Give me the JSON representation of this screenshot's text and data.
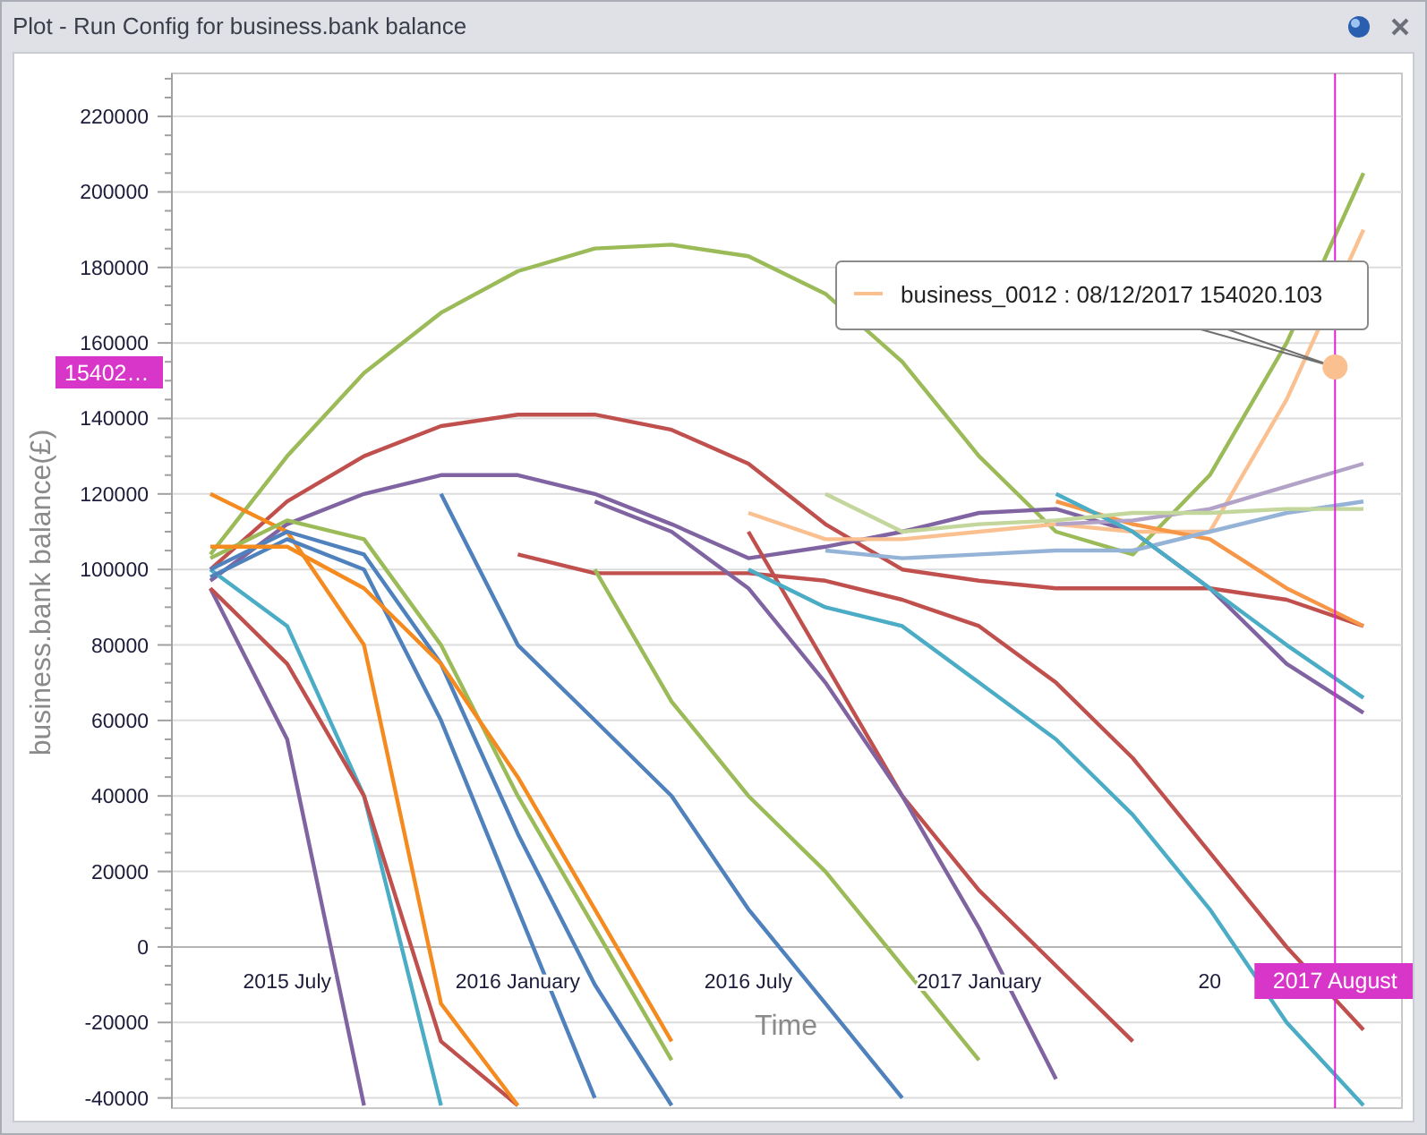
{
  "window": {
    "title": "Plot - Run Config for business.bank balance"
  },
  "chart_data": {
    "type": "line",
    "xlabel": "Time",
    "ylabel": "business.bank balance(£)",
    "categories": [
      null,
      "2015 July",
      null,
      null,
      "2016 January",
      null,
      null,
      "2016 July",
      null,
      null,
      "2017 January",
      null,
      null,
      "20",
      null,
      null
    ],
    "grid": true,
    "ylim": [
      -42700,
      231400
    ],
    "yticks": [
      -40000,
      -20000,
      0,
      20000,
      40000,
      60000,
      80000,
      100000,
      120000,
      140000,
      160000,
      180000,
      200000,
      220000
    ],
    "series": [
      {
        "color": "#9bbb59",
        "values": [
          104000,
          130000,
          152000,
          168000,
          179000,
          185000,
          186000,
          183000,
          173000,
          155000,
          130000,
          110000,
          104000,
          125000,
          160000,
          205000
        ]
      },
      {
        "color": "#c0504d",
        "values": [
          100000,
          118000,
          130000,
          138000,
          141000,
          141000,
          137000,
          128000,
          112000,
          100000,
          97000,
          95000,
          95000,
          95000,
          92000,
          85000
        ]
      },
      {
        "color": "#8064a2",
        "values": [
          97000,
          112000,
          120000,
          125000,
          125000,
          120000,
          112000,
          103000,
          106000,
          110000,
          115000,
          116000,
          110000,
          95000,
          75000,
          62000
        ]
      },
      {
        "color": "#8064a2",
        "values": [
          95000,
          55000,
          -42000,
          null,
          null,
          null,
          null,
          null,
          null,
          null,
          null,
          null,
          null,
          null,
          null,
          null
        ]
      },
      {
        "color": "#4bacc6",
        "values": [
          100000,
          85000,
          40000,
          -42000,
          null,
          null,
          null,
          null,
          null,
          null,
          null,
          null,
          null,
          null,
          null,
          null
        ]
      },
      {
        "color": "#c0504d",
        "values": [
          95000,
          75000,
          40000,
          -25000,
          -42000,
          null,
          null,
          null,
          null,
          null,
          null,
          null,
          null,
          null,
          null,
          null
        ]
      },
      {
        "color": "#f58a1f",
        "values": [
          120000,
          110000,
          80000,
          -15000,
          -42000,
          null,
          null,
          null,
          null,
          null,
          null,
          null,
          null,
          null,
          null,
          null
        ]
      },
      {
        "color": "#4f81bd",
        "values": [
          98000,
          108000,
          100000,
          60000,
          10000,
          -40000,
          null,
          null,
          null,
          null,
          null,
          null,
          null,
          null,
          null,
          null
        ]
      },
      {
        "color": "#4f81bd",
        "values": [
          100000,
          110000,
          104000,
          75000,
          30000,
          -10000,
          -42000,
          null,
          null,
          null,
          null,
          null,
          null,
          null,
          null,
          null
        ]
      },
      {
        "color": "#9bbb59",
        "values": [
          103000,
          113000,
          108000,
          80000,
          40000,
          5000,
          -30000,
          null,
          null,
          null,
          null,
          null,
          null,
          null,
          null,
          null
        ]
      },
      {
        "color": "#f58a1f",
        "values": [
          106000,
          106000,
          95000,
          75000,
          45000,
          10000,
          -25000,
          null,
          null,
          null,
          null,
          null,
          null,
          null,
          null,
          null
        ]
      },
      {
        "color": "#4f81bd",
        "values": [
          null,
          null,
          null,
          120000,
          80000,
          60000,
          40000,
          10000,
          -15000,
          -40000,
          null,
          null,
          null,
          null,
          null,
          null
        ]
      },
      {
        "color": "#c0504d",
        "values": [
          null,
          null,
          null,
          null,
          104000,
          99000,
          99000,
          99000,
          97000,
          92000,
          85000,
          70000,
          50000,
          25000,
          0,
          -22000
        ]
      },
      {
        "color": "#c0504d",
        "values": [
          null,
          null,
          null,
          null,
          null,
          null,
          null,
          110000,
          75000,
          40000,
          15000,
          -5000,
          -25000,
          null,
          null,
          null
        ]
      },
      {
        "color": "#9bbb59",
        "values": [
          null,
          null,
          null,
          null,
          null,
          100000,
          65000,
          40000,
          20000,
          -5000,
          -30000,
          null,
          null,
          null,
          null,
          null
        ]
      },
      {
        "color": "#8064a2",
        "values": [
          null,
          null,
          null,
          null,
          null,
          118000,
          110000,
          95000,
          70000,
          40000,
          5000,
          -35000,
          null,
          null,
          null,
          null
        ]
      },
      {
        "color": "#4bacc6",
        "values": [
          null,
          null,
          null,
          null,
          null,
          null,
          null,
          100000,
          90000,
          85000,
          70000,
          55000,
          35000,
          10000,
          -20000,
          -42000
        ]
      },
      {
        "color": "#fac090",
        "values": [
          null,
          null,
          null,
          null,
          null,
          null,
          null,
          115000,
          108000,
          108000,
          110000,
          112000,
          110000,
          110000,
          145000,
          190000
        ]
      },
      {
        "color": "#f79646",
        "values": [
          null,
          null,
          null,
          null,
          null,
          null,
          null,
          null,
          null,
          null,
          null,
          118000,
          112000,
          108000,
          95000,
          85000
        ]
      },
      {
        "color": "#95b3d7",
        "values": [
          null,
          null,
          null,
          null,
          null,
          null,
          null,
          null,
          105000,
          103000,
          104000,
          105000,
          105000,
          110000,
          115000,
          118000
        ]
      },
      {
        "color": "#b3a2c7",
        "values": [
          null,
          null,
          null,
          null,
          null,
          null,
          null,
          null,
          null,
          null,
          null,
          112000,
          113000,
          116000,
          122000,
          128000
        ]
      },
      {
        "color": "#4bacc6",
        "values": [
          null,
          null,
          null,
          null,
          null,
          null,
          null,
          null,
          null,
          null,
          null,
          120000,
          110000,
          95000,
          80000,
          66000
        ]
      },
      {
        "color": "#c3d69b",
        "values": [
          null,
          null,
          null,
          null,
          null,
          null,
          null,
          null,
          120000,
          110000,
          112000,
          113000,
          115000,
          115000,
          116000,
          116000
        ]
      }
    ],
    "annotations": [
      "business_0012 : 08/12/2017 154020.103"
    ]
  },
  "tooltip": {
    "color": "#fac090"
  },
  "crosshair": {
    "x_label": "2017 August",
    "y_label": "15402…"
  }
}
